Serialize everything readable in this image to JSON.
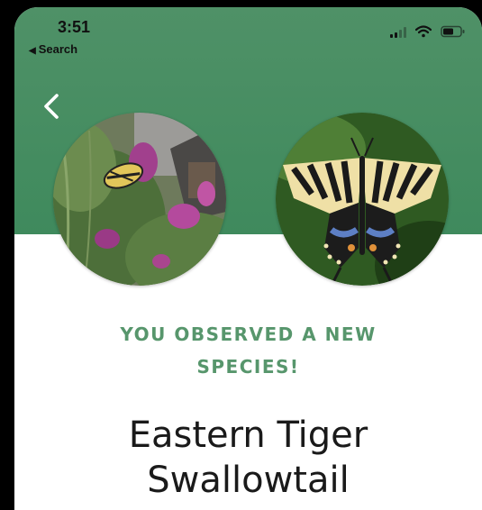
{
  "status_bar": {
    "time": "3:51",
    "back_app_label": "Search",
    "icons": [
      "cellular-signal-icon",
      "wifi-icon",
      "battery-icon"
    ]
  },
  "nav": {
    "back_icon": "chevron-left-icon"
  },
  "photos": {
    "observation_photo": "user observation photo: swallowtail butterfly on purple butterfly bush",
    "reference_photo": "reference photo: Eastern Tiger Swallowtail, wings spread"
  },
  "banner": {
    "line1": "YOU OBSERVED A NEW",
    "line2": "SPECIES!"
  },
  "species": {
    "line1": "Eastern Tiger",
    "line2": "Swallowtail"
  },
  "colors": {
    "header_green": "#4a8f63",
    "banner_green": "#57966c",
    "species_text": "#1a1a1a"
  }
}
